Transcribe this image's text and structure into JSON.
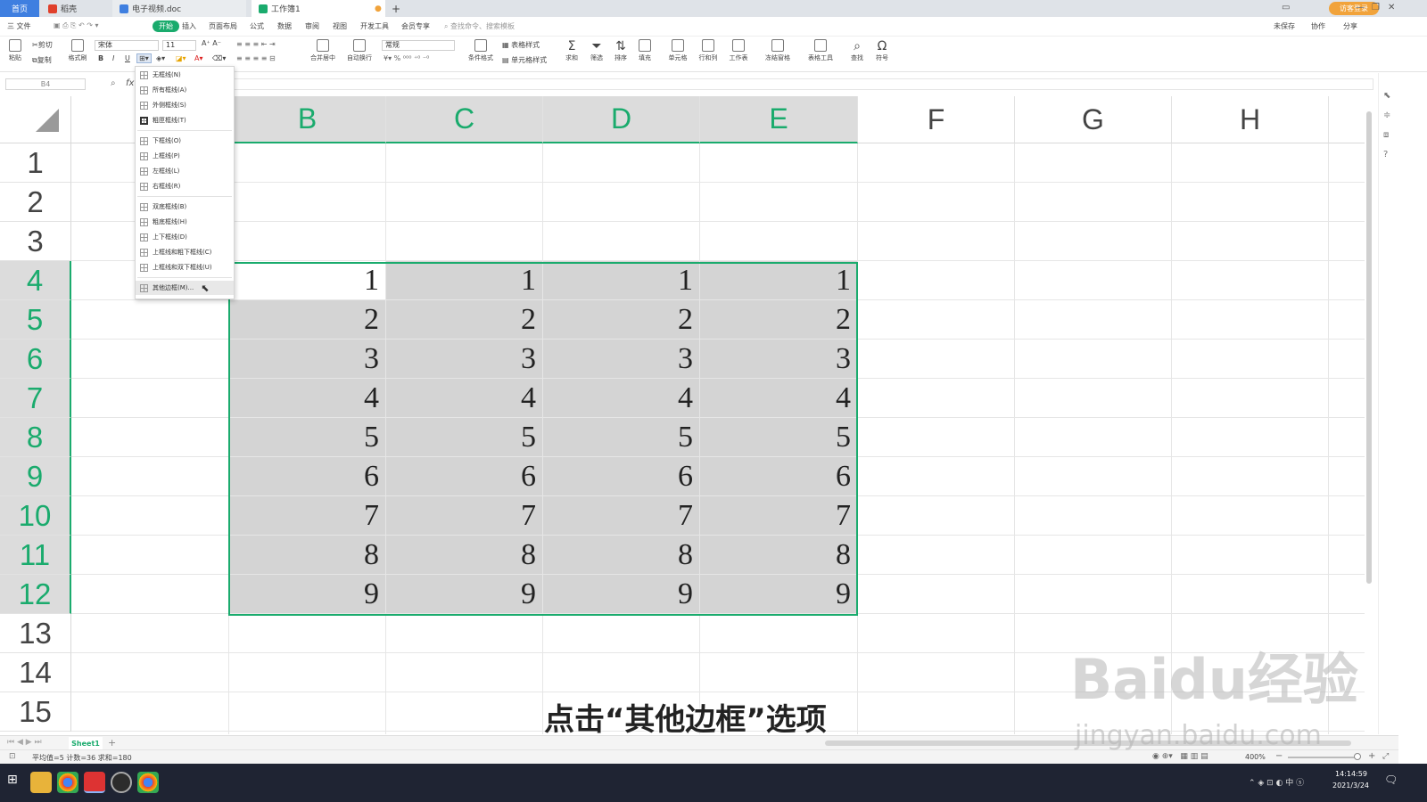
{
  "tabs": {
    "home": "首页",
    "dao": "稻壳",
    "doc": "电子视频.doc",
    "book": "工作簿1",
    "new_tab": "+"
  },
  "account": {
    "login": "访客登录"
  },
  "menu": {
    "file": "三 文件",
    "items": [
      "开始",
      "插入",
      "页面布局",
      "公式",
      "数据",
      "审阅",
      "视图",
      "开发工具",
      "会员专享"
    ],
    "search": "查找命令、搜索模板",
    "right": [
      "未保存",
      "协作",
      "分享"
    ]
  },
  "ribbon": {
    "paste": "粘贴",
    "cut": "剪切",
    "copy": "复制",
    "format_brush": "格式刷",
    "font_name": "宋体",
    "font_size": "11",
    "bold": "B",
    "italic": "I",
    "underline": "U",
    "merge": "合并居中",
    "wrap": "自动换行",
    "number_format": "常规",
    "cond_format": "条件格式",
    "table_style": "表格样式",
    "cell_style": "单元格样式",
    "sum": "求和",
    "filter": "筛选",
    "sort": "排序",
    "fill": "填充",
    "cell": "单元格",
    "rowcol": "行和列",
    "sheet": "工作表",
    "freeze": "冻结窗格",
    "table_tools": "表格工具",
    "find": "查找",
    "symbol": "符号"
  },
  "formula_bar": {
    "name_box": "B4",
    "fx": "fx"
  },
  "columns": [
    "B",
    "C",
    "D",
    "E",
    "F",
    "G",
    "H"
  ],
  "rows": [
    "1",
    "2",
    "3",
    "4",
    "5",
    "6",
    "7",
    "8",
    "9",
    "10",
    "11",
    "12",
    "13",
    "14",
    "15"
  ],
  "cell_values": {
    "row4": [
      "1",
      "1",
      "1",
      "1"
    ],
    "row5": [
      "2",
      "2",
      "2",
      "2"
    ],
    "row6": [
      "3",
      "3",
      "3",
      "3"
    ],
    "row7": [
      "4",
      "4",
      "4",
      "4"
    ],
    "row8": [
      "5",
      "5",
      "5",
      "5"
    ],
    "row9": [
      "6",
      "6",
      "6",
      "6"
    ],
    "row10": [
      "7",
      "7",
      "7",
      "7"
    ],
    "row11": [
      "8",
      "8",
      "8",
      "8"
    ],
    "row12": [
      "9",
      "9",
      "9",
      "9"
    ]
  },
  "border_menu": {
    "items": [
      "无框线(N)",
      "所有框线(A)",
      "外侧框线(S)",
      "粗匣框线(T)",
      "下框线(O)",
      "上框线(P)",
      "左框线(L)",
      "右框线(R)",
      "双底框线(B)",
      "粗底框线(H)",
      "上下框线(D)",
      "上框线和粗下框线(C)",
      "上框线和双下框线(U)",
      "其他边框(M)..."
    ],
    "highlighted_index": 13
  },
  "sheet_tabs": {
    "active": "Sheet1",
    "add": "+"
  },
  "status": {
    "stats": "平均值=5  计数=36  求和=180",
    "zoom": "400%"
  },
  "taskbar": {
    "time": "14:14:59",
    "date": "2021/3/24"
  },
  "subtitle": "点击“其他边框”选项",
  "watermark": {
    "main": "Baidu经验",
    "url": "jingyan.baidu.com"
  },
  "colors": {
    "accent": "#1aab6d",
    "selection": "#d4d4d4",
    "home_tab": "#3f7fe0"
  }
}
